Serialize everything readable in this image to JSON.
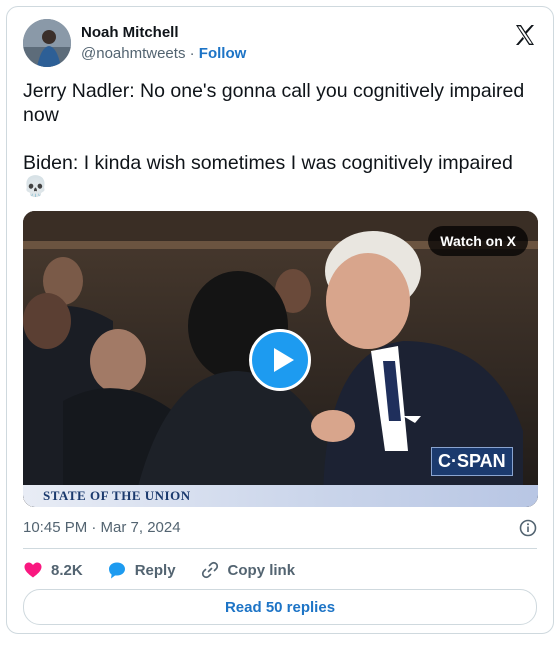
{
  "author": {
    "name": "Noah Mitchell",
    "handle": "@noahmtweets",
    "separator": "·",
    "follow_label": "Follow"
  },
  "tweet": {
    "line1": "Jerry Nadler: No one's gonna call you cognitively impaired now",
    "line2": "Biden: I kinda wish sometimes I was cognitively impaired",
    "emoji": "💀"
  },
  "media": {
    "watch_label": "Watch on X",
    "network_logo_text": "C·SPAN",
    "banner_text": "STATE OF THE UNION"
  },
  "meta": {
    "timestamp": "10:45 PM · Mar 7, 2024"
  },
  "actions": {
    "likes_count": "8.2K",
    "reply_label": "Reply",
    "copy_label": "Copy link",
    "read_replies_label": "Read 50 replies"
  },
  "colors": {
    "accent": "#1d9bf0",
    "link": "#1d74c6",
    "like": "#f91880",
    "muted": "#536471",
    "border": "#cfd9de"
  }
}
